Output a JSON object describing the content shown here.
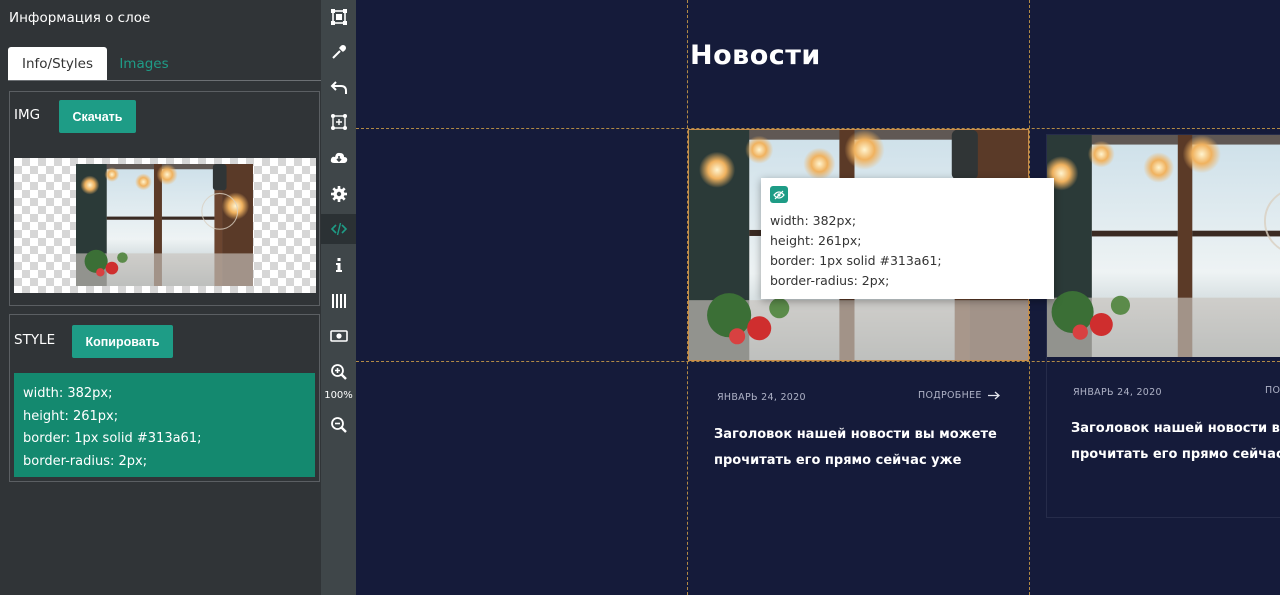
{
  "panel": {
    "title": "Информация о слое",
    "tabs": [
      {
        "label": "Info/Styles",
        "active": true
      },
      {
        "label": "Images",
        "active": false
      }
    ],
    "image_section": {
      "label": "IMG",
      "button": "Скачать"
    },
    "style_section": {
      "label": "STYLE",
      "button": "Копировать",
      "lines": [
        "width: 382px;",
        "height: 261px;",
        "border: 1px solid #313a61;",
        "border-radius: 2px;"
      ]
    }
  },
  "toolbar": {
    "tools": [
      "select-frame-icon",
      "eyedropper-icon",
      "undo-icon",
      "transform-icon",
      "cloud-download-icon",
      "gear-icon",
      "code-icon",
      "info-icon",
      "grid-columns-icon",
      "money-icon",
      "zoom-in-icon",
      "zoom-out-icon"
    ],
    "active_tool": "code-icon",
    "zoom": "100%"
  },
  "canvas": {
    "section_title": "Новости",
    "cards": [
      {
        "date": "ЯНВАРЬ 24, 2020",
        "more": "ПОДРОБНЕЕ",
        "title_lines": [
          "Заголовок нашей новости вы можете",
          "прочитать его прямо сейчас уже"
        ]
      },
      {
        "date": "ЯНВАРЬ 24, 2020",
        "more": "ПО",
        "title_lines": [
          "Заголовок нашей новости вы м",
          "прочитать его прямо сейчас у"
        ]
      }
    ],
    "tooltip": {
      "lines": [
        "width: 382px;",
        "height: 261px;",
        "border: 1px solid #313a61;",
        "border-radius: 2px;"
      ]
    }
  },
  "colors": {
    "panel_bg": "#303437",
    "toolbar_bg": "#3f4649",
    "canvas_bg": "#151b3a",
    "accent_green": "#1e9c86",
    "guide": "#b28a45"
  }
}
